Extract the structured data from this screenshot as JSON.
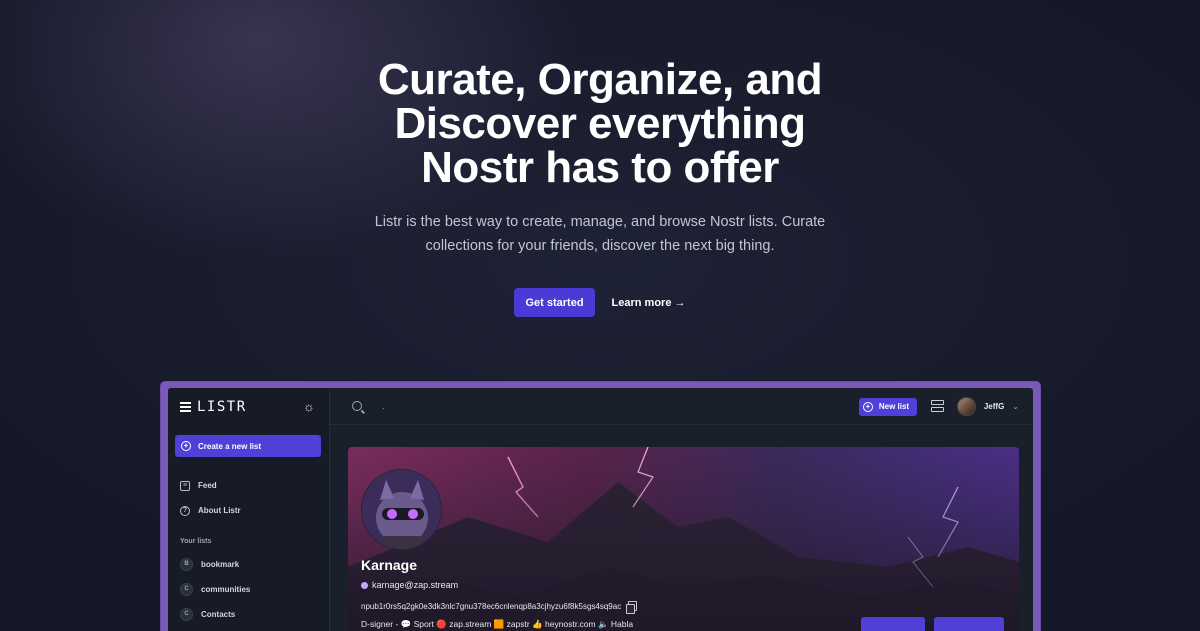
{
  "hero": {
    "title": "Curate, Organize, and Discover everything Nostr has to offer",
    "subtitle": "Listr is the best way to create, manage, and browse Nostr lists. Curate collections for your friends, discover the next big thing.",
    "primary_cta": "Get started",
    "secondary_cta": "Learn more →"
  },
  "app": {
    "logo_text": "LISTR",
    "sidebar": {
      "create_label": "Create a new list",
      "nav": [
        {
          "label": "Feed",
          "icon": "feed-icon"
        },
        {
          "label": "About Listr",
          "icon": "help-icon"
        }
      ],
      "section_label": "Your lists",
      "lists": [
        {
          "letter": "B",
          "label": "bookmark"
        },
        {
          "letter": "C",
          "label": "communities"
        },
        {
          "letter": "C",
          "label": "Contacts"
        }
      ]
    },
    "topbar": {
      "search_value": ".",
      "new_list_label": "New list",
      "user_name": "JeffG"
    },
    "profile": {
      "name": "Karnage",
      "nip05": "karnage@zap.stream",
      "npub": "npub1r0rs5q2gk0e3dk3nlc7gnu378ec6cnlenqp8a3cjhyzu6f8k5sgs4sq9ac",
      "about": "D-signer - 💬 Sport 🔴 zap.stream 🟧 zapstr 👍 heynostr.com 🔈 Habla"
    },
    "colors": {
      "accent": "#5140d8",
      "background": "#141827"
    }
  }
}
